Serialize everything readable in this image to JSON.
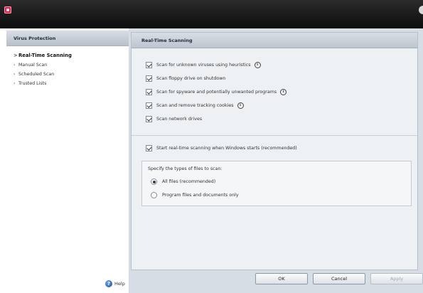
{
  "sidebar": {
    "header": "Virus Protection",
    "items": [
      {
        "label": "Real-Time Scanning"
      },
      {
        "label": "Manual Scan"
      },
      {
        "label": "Scheduled Scan"
      },
      {
        "label": "Trusted Lists"
      }
    ],
    "help_label": "Help"
  },
  "panel": {
    "title": "Real-Time Scanning",
    "options": [
      {
        "label": "Scan for unknown viruses using heuristics",
        "checked": true,
        "info": true
      },
      {
        "label": "Scan floppy drive on shutdown",
        "checked": true,
        "info": false
      },
      {
        "label": "Scan for spyware and potentially unwanted programs",
        "checked": true,
        "info": true
      },
      {
        "label": "Scan and remove tracking cookies",
        "checked": true,
        "info": true
      },
      {
        "label": "Scan network drives",
        "checked": true,
        "info": false
      }
    ],
    "startup_option": {
      "label": "Start real-time scanning when Windows starts (recommended)",
      "checked": true
    },
    "file_types": {
      "label": "Specify the types of files to scan:",
      "options": [
        {
          "label": "All files (recommended)",
          "selected": true
        },
        {
          "label": "Program files and documents only",
          "selected": false
        }
      ]
    }
  },
  "buttons": {
    "ok": "OK",
    "cancel": "Cancel",
    "apply": "Apply"
  },
  "icons": {
    "app": "app-logo-icon",
    "help": "help-icon",
    "info": "info-icon",
    "close": "close-icon"
  },
  "colors": {
    "title_bar": "#111111",
    "app_icon": "#d8204a",
    "panel_background": "#eef1f4",
    "frame_background": "#d7dde4"
  }
}
